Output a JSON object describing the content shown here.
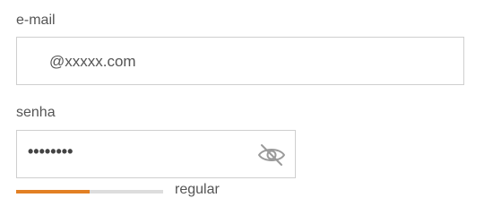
{
  "email": {
    "label": "e-mail",
    "value": "@xxxxx.com"
  },
  "password": {
    "label": "senha",
    "value": "••••••••",
    "toggle_icon": "eye-slash-icon"
  },
  "strength": {
    "level": 0.5,
    "label": "regular",
    "fill_color": "#e28024",
    "track_color": "#dddddd"
  }
}
